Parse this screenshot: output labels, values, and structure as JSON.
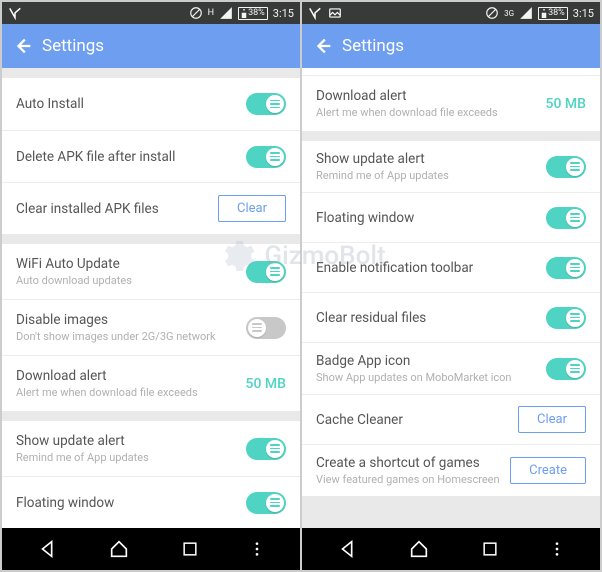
{
  "status": {
    "battery": "38%",
    "time": "3:15",
    "net_label_h": "H",
    "net_label_3g": "3G"
  },
  "appbar": {
    "title": "Settings"
  },
  "left": {
    "s1": {
      "r0": {
        "title": "Auto Install"
      },
      "r1": {
        "title": "Delete APK file after install"
      },
      "r2": {
        "title": "Clear installed APK files",
        "btn": "Clear"
      }
    },
    "s2": {
      "r0": {
        "title": "WiFi Auto Update",
        "sub": "Auto download updates"
      },
      "r1": {
        "title": "Disable images",
        "sub": "Don't show images under 2G/3G network"
      },
      "r2": {
        "title": "Download alert",
        "sub": "Alert me when download file exceeds",
        "val": "50 MB"
      }
    },
    "s3": {
      "r0": {
        "title": "Show update alert",
        "sub": "Remind me of App updates"
      },
      "r1": {
        "title": "Floating window"
      }
    }
  },
  "right": {
    "top": {
      "r0": {
        "title": "Download alert",
        "sub": "Alert me when download file exceeds",
        "val": "50 MB"
      }
    },
    "s1": {
      "r0": {
        "title": "Show update alert",
        "sub": "Remind me of App updates"
      },
      "r1": {
        "title": "Floating window"
      },
      "r2": {
        "title": "Enable notification toolbar"
      },
      "r3": {
        "title": "Clear residual files"
      },
      "r4": {
        "title": "Badge App icon",
        "sub": "Show App updates on MoboMarket icon"
      },
      "r5": {
        "title": "Cache Cleaner",
        "btn": "Clear"
      },
      "r6": {
        "title": "Create a shortcut of games",
        "sub": "View featured games on Homescreen",
        "btn": "Create"
      }
    }
  },
  "watermark": {
    "text": "GizmoBolt"
  }
}
